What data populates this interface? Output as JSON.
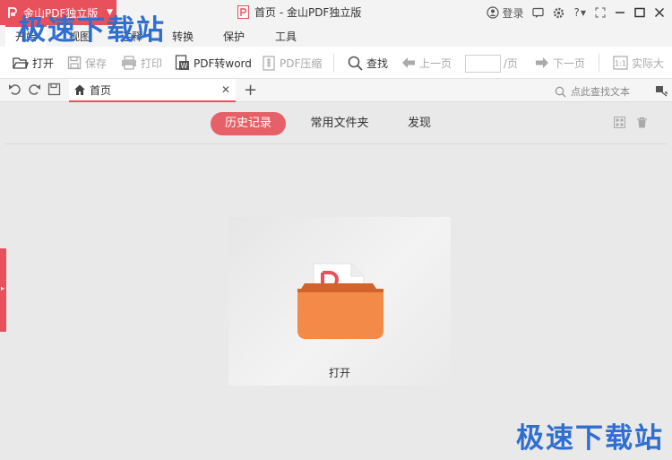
{
  "app": {
    "badge_name": "金山PDF独立版",
    "window_title": "首页 - 金山PDF独立版",
    "brand_color": "#e8505b"
  },
  "titlebar": {
    "login_label": "登录",
    "help_label": "?"
  },
  "ribbon_tabs": [
    {
      "label": "开始",
      "active": true
    },
    {
      "label": "视图",
      "active": false
    },
    {
      "label": "注释",
      "active": false
    },
    {
      "label": "转换",
      "active": false
    },
    {
      "label": "保护",
      "active": false
    },
    {
      "label": "工具",
      "active": false
    }
  ],
  "toolbar": {
    "open": "打开",
    "save": "保存",
    "print": "打印",
    "pdf_to_word": "PDF转word",
    "pdf_compress": "PDF压缩",
    "find": "查找",
    "prev_page": "上一页",
    "page_value": "",
    "page_suffix": "/页",
    "next_page": "下一页",
    "actual_size": "实际大"
  },
  "tabs": {
    "home_tab": "首页",
    "close_symbol": "✕",
    "add_symbol": "+",
    "search_placeholder": "点此查找文本"
  },
  "content": {
    "pills": [
      {
        "label": "历史记录",
        "active": true
      },
      {
        "label": "常用文件夹",
        "active": false
      },
      {
        "label": "发现",
        "active": false
      }
    ],
    "open_label": "打开"
  },
  "watermark": {
    "text_top": "极速下载站",
    "text_bottom": "极速下载站"
  },
  "icons": [
    "pdf-logo-icon",
    "user-icon",
    "message-icon",
    "gear-icon",
    "fullscreen-icon",
    "minimize-icon",
    "maximize-icon",
    "close-icon",
    "open-folder-icon",
    "save-icon",
    "print-icon",
    "pdf-to-word-icon",
    "pdf-compress-icon",
    "search-icon",
    "arrow-left-icon",
    "arrow-right-icon",
    "actual-size-icon",
    "undo-icon",
    "redo-icon",
    "home-icon",
    "grid-view-icon",
    "trash-icon",
    "folder-icon"
  ]
}
